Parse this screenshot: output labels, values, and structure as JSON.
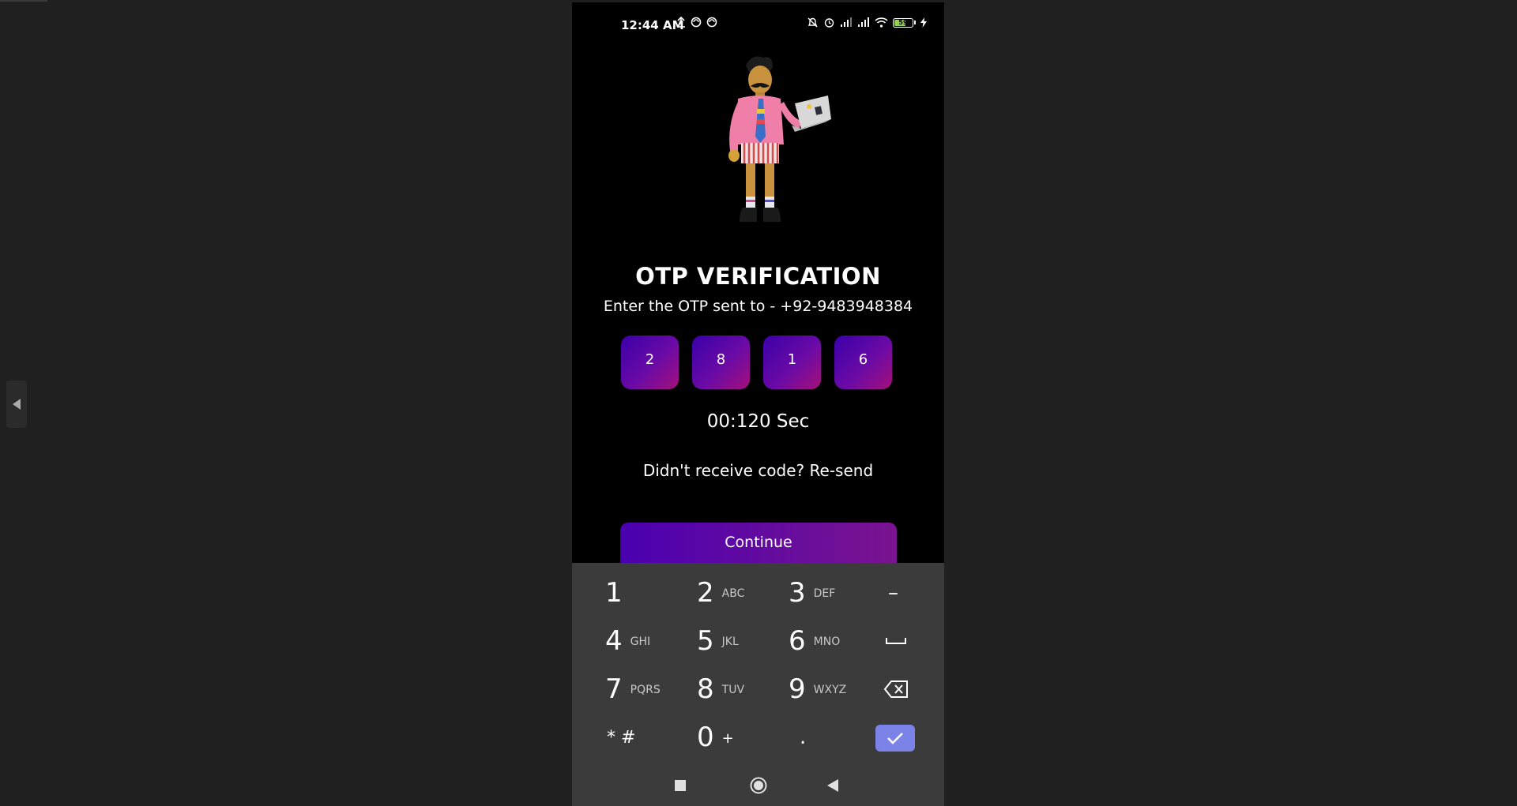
{
  "status_bar": {
    "time": "12:44 AM",
    "battery": "59",
    "left_icons": [
      "upload-icon",
      "sync-icon",
      "sync-icon"
    ],
    "right_icons": [
      "bell-off-icon",
      "alarm-icon",
      "signal-icon",
      "signal-icon",
      "wifi-icon",
      "battery-icon",
      "charging-icon"
    ]
  },
  "otp": {
    "title": "OTP VERIFICATION",
    "subtitle": "Enter the OTP sent to - +92-9483948384",
    "digits": [
      "2",
      "8",
      "1",
      "6"
    ],
    "timer": "00:120 Sec",
    "resend_prefix": "Didn't receive code? ",
    "resend_link": "Re-send",
    "continue_label": "Continue"
  },
  "keyboard": {
    "row1": [
      {
        "num": "1",
        "letters": ""
      },
      {
        "num": "2",
        "letters": "ABC"
      },
      {
        "num": "3",
        "letters": "DEF"
      },
      {
        "sym": "–"
      }
    ],
    "row2": [
      {
        "num": "4",
        "letters": "GHI"
      },
      {
        "num": "5",
        "letters": "JKL"
      },
      {
        "num": "6",
        "letters": "MNO"
      }
    ],
    "row3": [
      {
        "num": "7",
        "letters": "PQRS"
      },
      {
        "num": "8",
        "letters": "TUV"
      },
      {
        "num": "9",
        "letters": "WXYZ"
      }
    ],
    "row4": [
      {
        "sym": "* #"
      },
      {
        "num": "0",
        "letters": "+"
      },
      {
        "sym": "."
      }
    ]
  },
  "colors": {
    "otp_gradient_start": "#3a00a8",
    "otp_gradient_end": "#a4107a",
    "continue_start": "#4a00b0",
    "continue_end": "#7a1490",
    "enter_key": "#7c83e8",
    "keyboard_bg": "#3b3b3b"
  }
}
